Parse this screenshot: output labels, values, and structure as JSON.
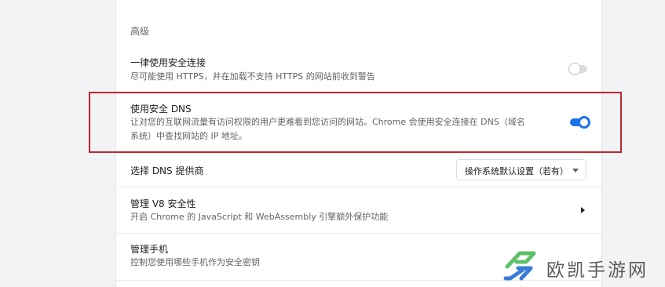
{
  "section_title": "高级",
  "https_only": {
    "title": "一律使用安全连接",
    "description": "尽可能使用 HTTPS，并在加载不支持 HTTPS 的网站前收到警告",
    "enabled": false
  },
  "secure_dns": {
    "title": "使用安全 DNS",
    "description_line1": "让对您的互联网流量有访问权限的用户更难看到您访问的网站。Chrome 会使用安全连接在 DNS（域名",
    "description_line2": "系统）中查找网站的 IP 地址。",
    "enabled": true
  },
  "dns_provider": {
    "label": "选择 DNS 提供商",
    "selected": "操作系统默认设置（若有）"
  },
  "v8_security": {
    "title": "管理 V8 安全性",
    "description": "开启 Chrome 的 JavaScript 和 WebAssembly 引擎额外保护功能"
  },
  "manage_phones": {
    "title": "管理手机",
    "description": "控制您使用哪些手机作为安全密钥"
  },
  "watermark": {
    "text": "欧凯手游网",
    "colors": {
      "green": "#5fc06c",
      "blue": "#3a7bd5"
    }
  }
}
